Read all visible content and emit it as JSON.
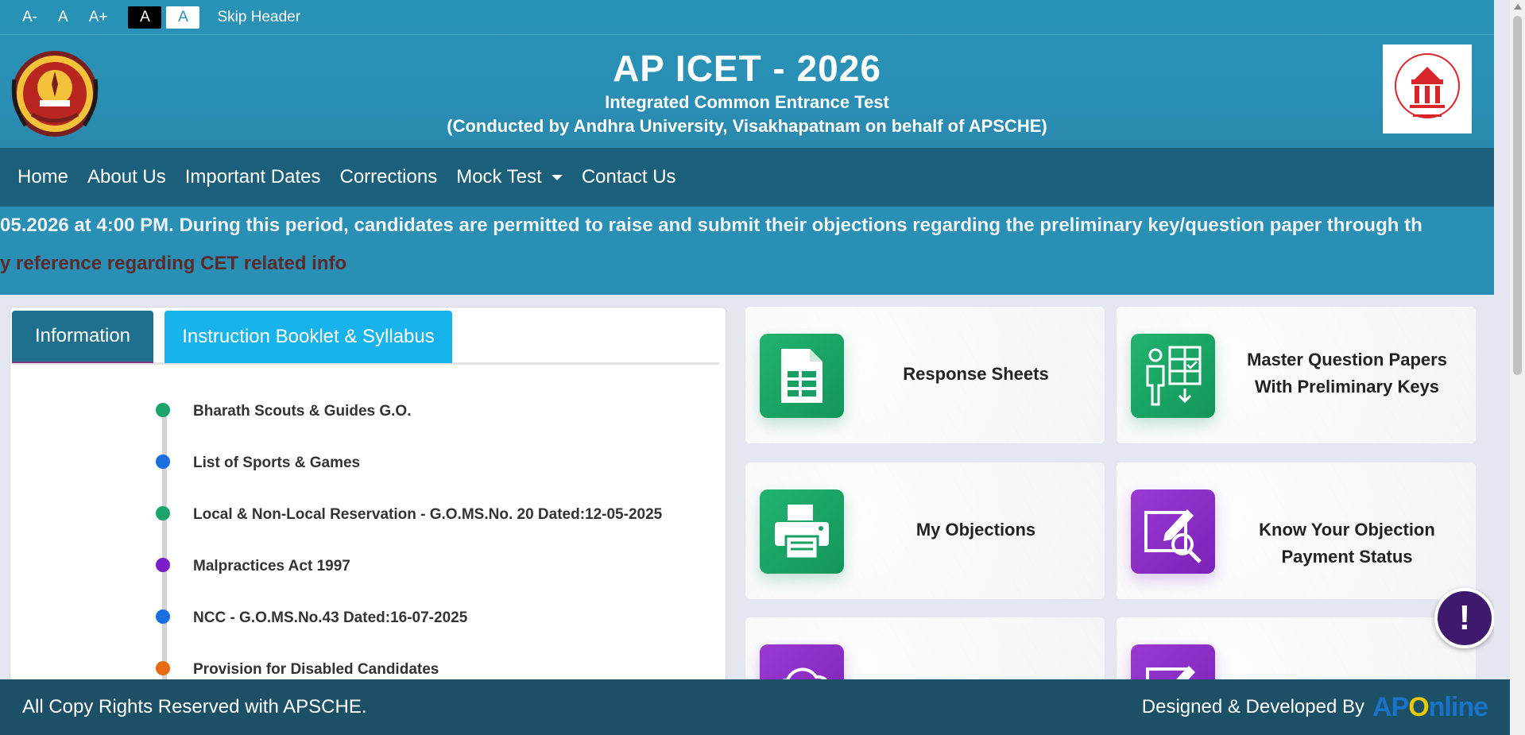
{
  "accessibility": {
    "font_decrease": "A-",
    "font_normal": "A",
    "font_increase": "A+",
    "contrast_dark": "A",
    "contrast_light": "A",
    "skip_header": "Skip Header"
  },
  "header": {
    "title": "AP ICET - 2026",
    "subtitle": "Integrated Common Entrance Test",
    "conducted_by": "(Conducted by Andhra University, Visakhapatnam on behalf of APSCHE)"
  },
  "nav": {
    "items": [
      {
        "label": "Home"
      },
      {
        "label": "About Us"
      },
      {
        "label": "Important Dates"
      },
      {
        "label": "Corrections"
      },
      {
        "label": "Mock Test"
      },
      {
        "label": "Contact Us"
      }
    ]
  },
  "marquee": {
    "line1": "05.2026 at 4:00 PM. During this period, candidates are permitted to raise and submit their objections regarding the preliminary key/question paper through th",
    "line2": "y reference regarding CET related info"
  },
  "info_panel": {
    "tabs": [
      {
        "label": "Information",
        "active": true
      },
      {
        "label": "Instruction Booklet & Syllabus",
        "active": false
      }
    ],
    "items": [
      {
        "label": "Bharath Scouts & Guides G.O.",
        "color": "#1aa36a"
      },
      {
        "label": "List of Sports & Games",
        "color": "#1a6ee0"
      },
      {
        "label": "Local & Non-Local Reservation - G.O.MS.No. 20 Dated:12-05-2025",
        "color": "#1aa36a"
      },
      {
        "label": "Malpractices Act 1997",
        "color": "#7a1fc8"
      },
      {
        "label": "NCC - G.O.MS.No.43 Dated:16-07-2025",
        "color": "#1a6ee0"
      },
      {
        "label": "Provision for Disabled Candidates",
        "color": "#e66a12"
      }
    ]
  },
  "cards": [
    {
      "label": "Response Sheets",
      "icon": "spreadsheet-icon",
      "color": "green"
    },
    {
      "label_line1": "Master Question Papers",
      "label_line2": "With Preliminary Keys",
      "icon": "person-grid-download-icon",
      "color": "green"
    },
    {
      "label": "My Objections",
      "icon": "printer-icon",
      "color": "green"
    },
    {
      "label_line1": "Know Your Objection",
      "label_line2": "Payment Status",
      "icon": "edit-search-icon",
      "color": "purple"
    }
  ],
  "help": {
    "symbol": "!"
  },
  "footer": {
    "copyright": "All Copy Rights Reserved with APSCHE.",
    "designed_by": "Designed & Developed By",
    "brand_ap": "AP",
    "brand_o": "O",
    "brand_nline": "nline"
  }
}
